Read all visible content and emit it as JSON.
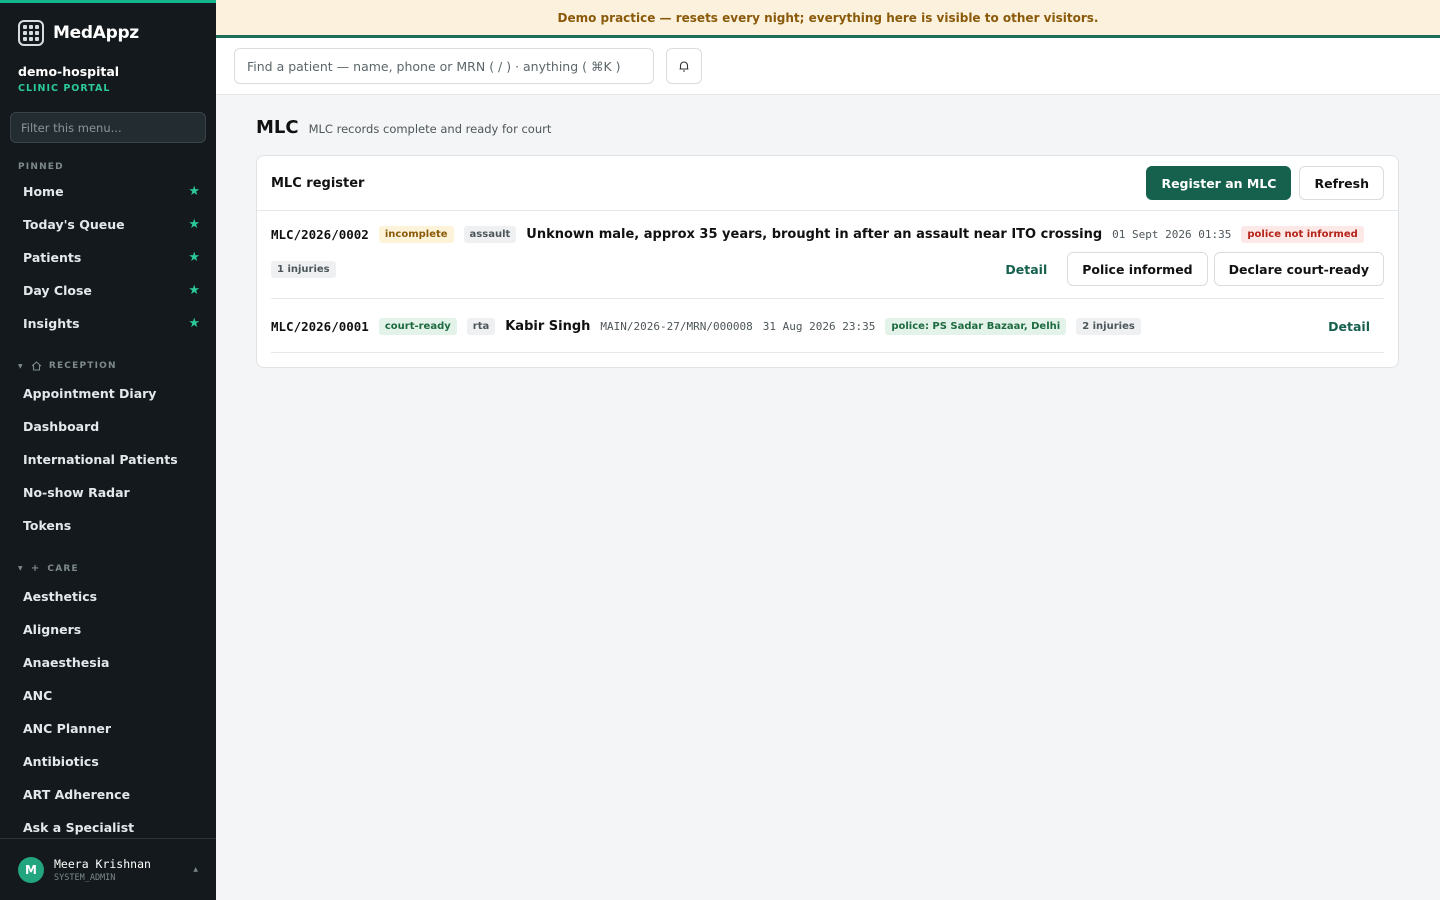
{
  "banner": {
    "text": "Demo practice — resets every night; everything here is visible to other visitors."
  },
  "brand": {
    "name": "MedAppz"
  },
  "hospital": {
    "name": "demo-hospital",
    "subtitle": "CLINIC PORTAL"
  },
  "sidebar": {
    "filter_placeholder": "Filter this menu...",
    "pinned_label": "PINNED",
    "pinned": [
      {
        "label": "Home"
      },
      {
        "label": "Today's Queue"
      },
      {
        "label": "Patients"
      },
      {
        "label": "Day Close"
      },
      {
        "label": "Insights"
      }
    ],
    "reception_label": "RECEPTION",
    "reception": [
      {
        "label": "Appointment Diary"
      },
      {
        "label": "Dashboard"
      },
      {
        "label": "International Patients"
      },
      {
        "label": "No-show Radar"
      },
      {
        "label": "Tokens"
      }
    ],
    "care_label": "CARE",
    "care": [
      {
        "label": "Aesthetics"
      },
      {
        "label": "Aligners"
      },
      {
        "label": "Anaesthesia"
      },
      {
        "label": "ANC"
      },
      {
        "label": "ANC Planner"
      },
      {
        "label": "Antibiotics"
      },
      {
        "label": "ART Adherence"
      },
      {
        "label": "Ask a Specialist"
      }
    ]
  },
  "user": {
    "initial": "M",
    "name": "Meera Krishnan",
    "role": "SYSTEM_ADMIN"
  },
  "search": {
    "placeholder": "Find a patient — name, phone or MRN ( / ) · anything ( ⌘K )"
  },
  "page": {
    "title": "MLC",
    "subtitle": "MLC records complete and ready for court"
  },
  "card": {
    "title": "MLC register",
    "register_label": "Register an MLC",
    "refresh_label": "Refresh"
  },
  "records": [
    {
      "id": "MLC/2026/0002",
      "status": "incomplete",
      "category": "assault",
      "title": "Unknown male, approx 35 years, brought in after an assault near ITO crossing",
      "datetime": "01 Sept 2026 01:35",
      "police": "police not informed",
      "injuries": "1 injuries",
      "detail_label": "Detail",
      "police_informed_label": "Police informed",
      "court_ready_label": "Declare court-ready"
    },
    {
      "id": "MLC/2026/0001",
      "status": "court-ready",
      "category": "rta",
      "title": "Kabir Singh",
      "mrn": "MAIN/2026-27/MRN/000008",
      "datetime": "31 Aug 2026 23:35",
      "police": "police: PS Sadar Bazaar, Delhi",
      "injuries": "2 injuries",
      "detail_label": "Detail"
    }
  ]
}
